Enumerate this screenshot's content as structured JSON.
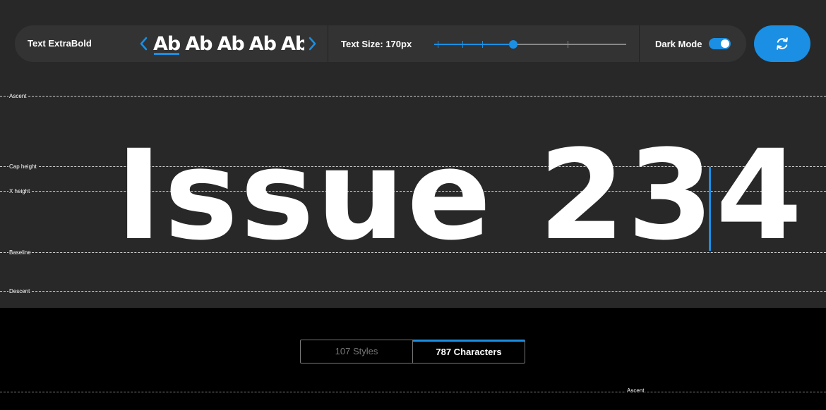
{
  "toolbar": {
    "style_name": "Text ExtraBold",
    "samples": [
      "Ab",
      "Ab",
      "Ab",
      "Ab",
      "Ab"
    ],
    "active_sample_index": 0,
    "prev_icon": "chevron-left-icon",
    "next_icon": "chevron-right-icon",
    "size_label": "Text Size: 170px",
    "size_slider_level": 0.41,
    "dark_mode_label": "Dark Mode",
    "dark_mode_on": true,
    "refresh_icon": "refresh-icon"
  },
  "guides": {
    "ascent": "Ascent",
    "cap_height": "Cap height",
    "x_height": "X height",
    "baseline": "Baseline",
    "descent": "Descent"
  },
  "specimen": {
    "text": "Issue 234"
  },
  "tabs": {
    "styles_label": "107 Styles",
    "characters_label": "787 Characters",
    "active": "characters"
  },
  "lower_guide": {
    "label": "Ascent"
  },
  "colors": {
    "accent": "#1a8fe3",
    "tester_bg": "#282828",
    "toolbar_bg": "#333333",
    "page_bg": "#000000"
  }
}
